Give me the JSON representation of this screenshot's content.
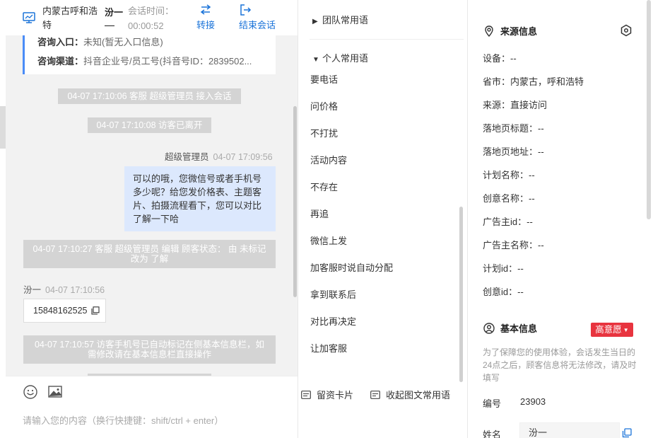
{
  "header": {
    "location": "内蒙古呼和浩特",
    "visitor_name": "汾一",
    "session_time_label": "会话时间：",
    "session_time": "00:00:52",
    "transfer_label": "转接",
    "end_label": "结束会话"
  },
  "info_card": {
    "entry_label": "咨询入口：",
    "entry_value": "未知(暂无入口信息)",
    "channel_label": "咨询渠道：",
    "channel_value": "抖音企业号/员工号(抖音号ID：2839502..."
  },
  "messages": {
    "sys1": "04-07 17:10:06 客服 超级管理员 接入会话",
    "sys2": "04-07 17:10:08 访客已离开",
    "agent_name": "超级管理员",
    "agent_time": "04-07 17:09:56",
    "agent_msg": "可以的哦，您微信号或者手机号多少呢？给您发价格表、主题客片、拍摄流程看下，您可以对比了解一下哈",
    "sys3": "04-07 17:10:27 客服 超级管理员 编辑 顾客状态： 由 未标记 改为 了解",
    "visitor_name": "汾一",
    "visitor_time": "04-07 17:10:56",
    "visitor_phone": "15848162525",
    "sys4": "04-07 17:10:57 访客手机号已自动标记在侧基本信息栏，如需修改请在基本信息栏直接操作"
  },
  "input": {
    "placeholder": "请输入您的内容（换行快捷键：shift/ctrl + enter）"
  },
  "phrases": {
    "team_group": "团队常用语",
    "personal_group": "个人常用语",
    "items": [
      "要电话",
      "问价格",
      "不打扰",
      "活动内容",
      "不存在",
      "再追",
      "微信上发",
      "加客服时说自动分配",
      "拿到联系后",
      "对比再决定",
      "让加客服"
    ],
    "card_label": "留资卡片",
    "collapse_label": "收起图文常用语"
  },
  "source_info": {
    "title": "来源信息",
    "device": "设备：--",
    "province_city": "省市：内蒙古，呼和浩特",
    "source": "来源：直接访问",
    "landing_title": "落地页标题：--",
    "landing_url": "落地页地址：--",
    "plan_name": "计划名称：--",
    "creative_name": "创意名称：--",
    "advertiser_id": "广告主id：--",
    "advertiser_name": "广告主名称：--",
    "plan_id": "计划id：--",
    "creative_id": "创意id：--"
  },
  "basic_info": {
    "title": "基本信息",
    "intent_badge": "高意愿",
    "note": "为了保障您的使用体验，会话发生当日的24点之后，顾客信息将无法修改，请及时填写",
    "id_label": "编号",
    "id_value": "23903",
    "name_label": "姓名",
    "name_value": "汾一"
  },
  "colors": {
    "accent": "#1a73d9",
    "bubble": "#dce8fd",
    "badge": "#e8343f"
  }
}
